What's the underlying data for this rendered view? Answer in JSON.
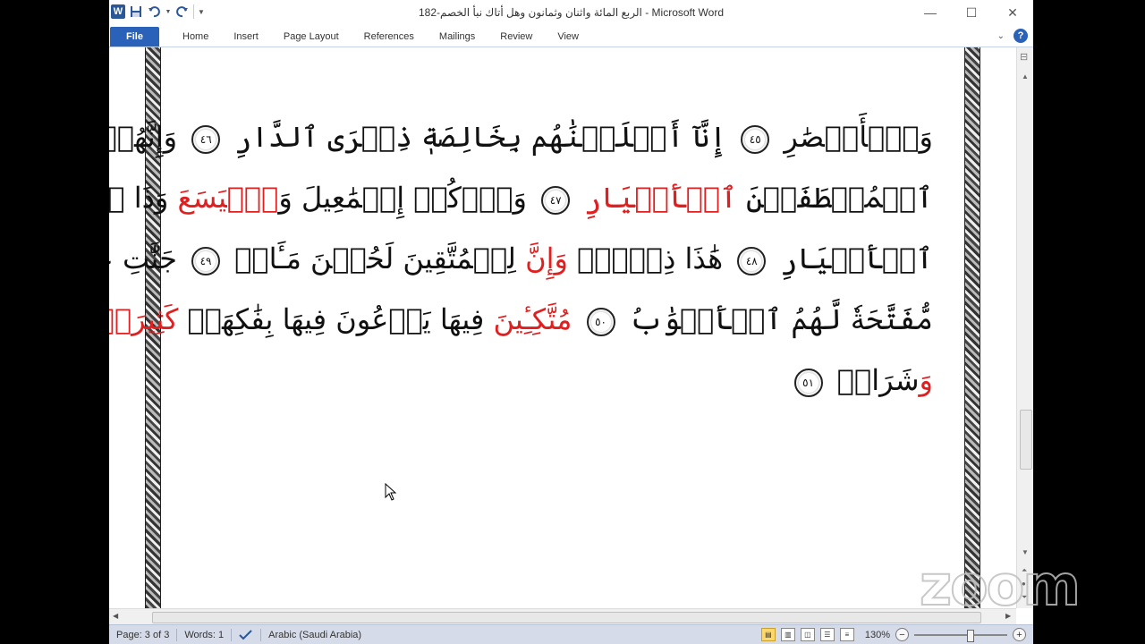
{
  "window": {
    "title": "الربع المائة واثنان وثمانون وهل أتاك نبأ الخصم-182  -  Microsoft Word"
  },
  "quick_access": {
    "icons": [
      "word-logo-icon",
      "save-icon",
      "undo-icon",
      "redo-icon",
      "customize-icon"
    ],
    "word_logo_letter": "W"
  },
  "window_controls": {
    "minimize": "—",
    "maximize": "☐",
    "close": "✕"
  },
  "ribbon": {
    "tabs": [
      "File",
      "Home",
      "Insert",
      "Page Layout",
      "References",
      "Mailings",
      "Review",
      "View"
    ],
    "help": "?"
  },
  "document": {
    "lines": [
      [
        {
          "t": "وَٱلۡأَبۡصَٰرِ ",
          "red": false
        },
        {
          "ayah": "٤٥"
        },
        {
          "t": " إِنَّآ أَخۡلَصۡنَٰهُم بِخَالِصَةٖ ذِكۡرَى ٱلدَّارِ ",
          "red": false
        },
        {
          "ayah": "٤٦"
        },
        {
          "t": " وَإِنَّهُمۡ عِندَنَا لَمِنَ",
          "red": false
        }
      ],
      [
        {
          "t": "ٱلۡمُصۡطَفَيۡنَ ",
          "red": false
        },
        {
          "t": "ٱلۡأَخۡيَارِ",
          "red": true
        },
        {
          "t": " ",
          "red": false
        },
        {
          "ayah": "٤٧"
        },
        {
          "t": " وَٱذۡكُرۡ إِسۡمَٰعِيلَ وَ",
          "red": false
        },
        {
          "t": "ٱلۡيَسَعَ",
          "red": true
        },
        {
          "t": " وَذَا ٱلۡكِفۡلِۖ وَكُلّٞ مِّنَ",
          "red": false
        }
      ],
      [
        {
          "t": "ٱلۡأَخۡيَارِ ",
          "red": false
        },
        {
          "ayah": "٤٨"
        },
        {
          "t": " هَٰذَا ذِكۡرٞۚ ",
          "red": false
        },
        {
          "t": "وَإِنَّ",
          "red": true
        },
        {
          "t": " لِلۡمُتَّقِينَ لَحُسۡنَ مَـَٔابٖ ",
          "red": false
        },
        {
          "ayah": "٤٩"
        },
        {
          "t": " جَنَّٰتِ عَدۡنٖ",
          "red": false
        }
      ],
      [
        {
          "t": "مُّفَتَّحَةٗ لَّهُمُ ٱلۡأَبۡوَٰبُ ",
          "red": false
        },
        {
          "ayah": "٥٠"
        },
        {
          "t": " مُتَّكِـِٔينَ",
          "red": true
        },
        {
          "t": " فِيهَا يَدۡعُونَ فِيهَا بِفَٰكِهَةٖ ",
          "red": false
        },
        {
          "t": "كَثِيرَةٖ",
          "red": true
        }
      ],
      [
        {
          "t": "وَ",
          "red": true
        },
        {
          "t": "شَرَابٖ ",
          "red": false
        },
        {
          "ayah": "٥١"
        }
      ]
    ]
  },
  "status_bar": {
    "page": "Page: 3 of 3",
    "words": "Words: 1",
    "language": "Arabic (Saudi Arabia)",
    "zoom_level": "130%",
    "zoom_fraction": 0.6
  },
  "watermark": {
    "text": "zoom"
  }
}
